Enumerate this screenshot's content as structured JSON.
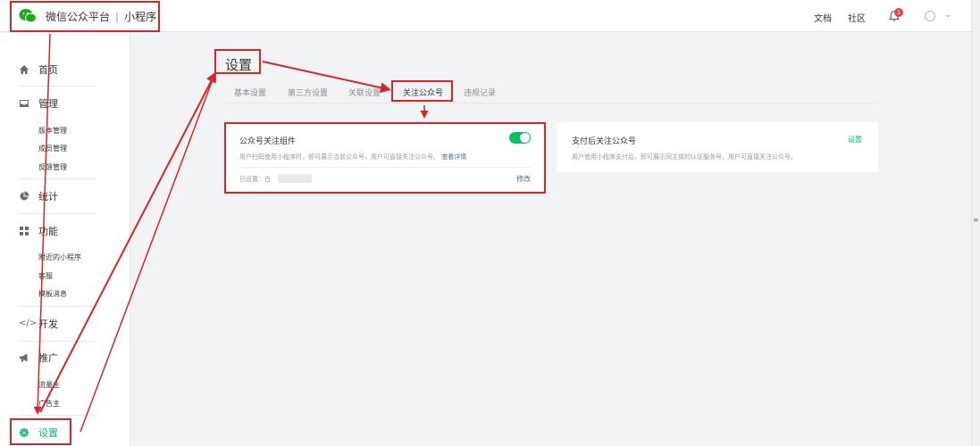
{
  "header": {
    "brand": "微信公众平台",
    "separator": "|",
    "product": "小程序",
    "links": {
      "docs": "文档",
      "community": "社区"
    },
    "notification_count": "1"
  },
  "sidebar": {
    "home": "首页",
    "manage": {
      "label": "管理",
      "items": [
        "版本管理",
        "成员管理",
        "反馈管理"
      ]
    },
    "stats": "统计",
    "features": {
      "label": "功能",
      "items": [
        "附近的小程序",
        "客服",
        "模板消息"
      ]
    },
    "develop": "开发",
    "promote": {
      "label": "推广",
      "items": [
        "流量主",
        "广告主"
      ]
    },
    "settings": "设置"
  },
  "main": {
    "title": "设置",
    "tabs": [
      "基本设置",
      "第三方设置",
      "关联设置",
      "关注公众号",
      "违规记录"
    ],
    "active_tab": "关注公众号",
    "card_follow": {
      "title": "公众号关注组件",
      "desc": "用户扫码使用小程序时，即可展示当前公众号，用户可直接关注公众号。",
      "detail_link": "查看详情",
      "toggle_on": true,
      "status_label": "已设置：白",
      "modify": "修改"
    },
    "card_pay": {
      "title": "支付后关注公众号",
      "desc": "用户使用小程序支付后，即可展示同主体的认证服务号，用户可直接关注公众号。",
      "setup": "设置"
    }
  },
  "colors": {
    "accent": "#07c160",
    "annotation": "#d9242a",
    "link": "#576b95"
  }
}
